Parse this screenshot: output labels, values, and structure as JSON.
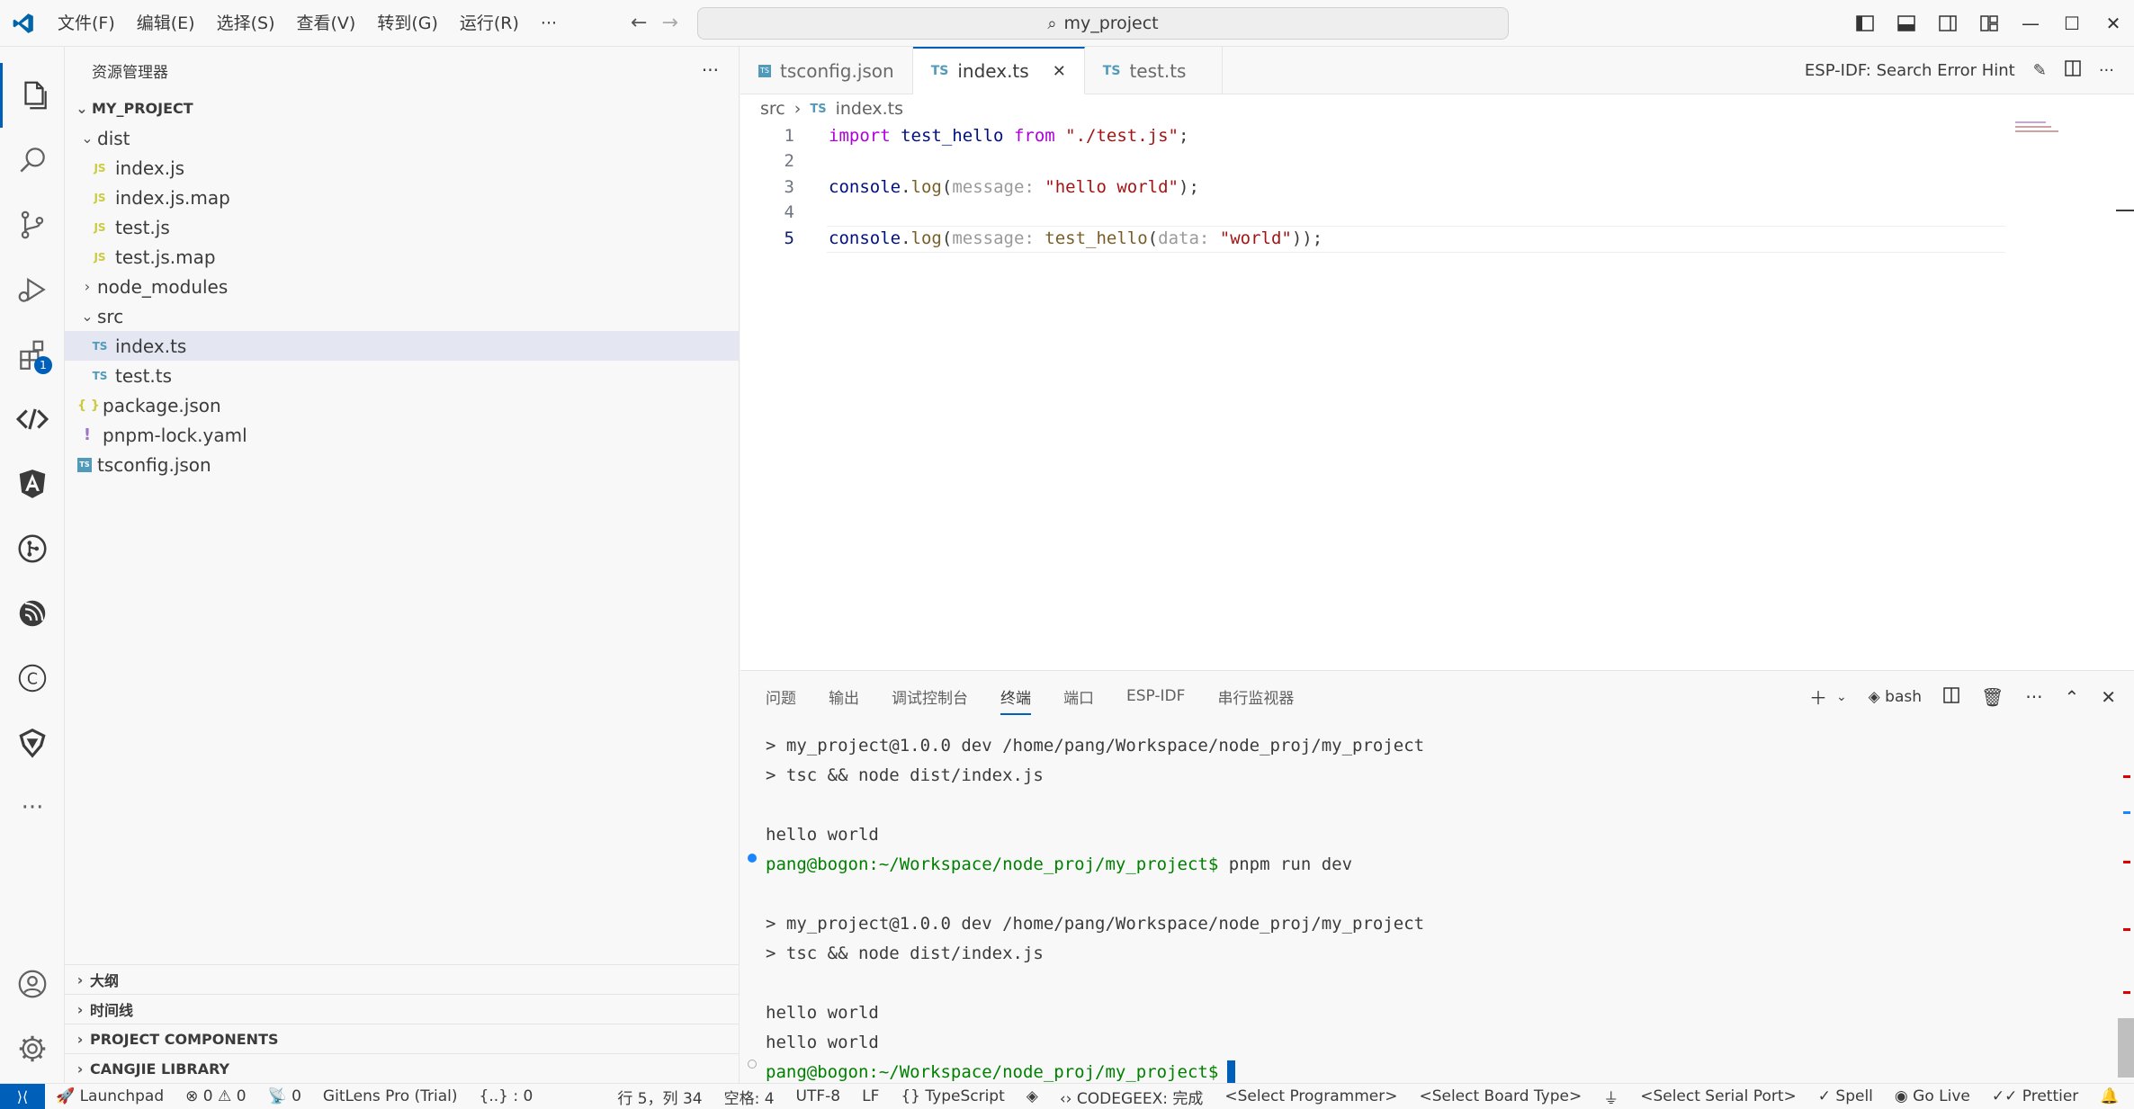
{
  "menu": [
    "文件(F)",
    "编辑(E)",
    "选择(S)",
    "查看(V)",
    "转到(G)",
    "运行(R)",
    "···"
  ],
  "search": {
    "text": "my_project"
  },
  "sidebar": {
    "title": "资源管理器",
    "project": "MY_PROJECT",
    "tree": [
      {
        "label": "dist",
        "type": "folder-open",
        "depth": 1
      },
      {
        "label": "index.js",
        "type": "JS",
        "depth": 2
      },
      {
        "label": "index.js.map",
        "type": "JS",
        "depth": 2
      },
      {
        "label": "test.js",
        "type": "JS",
        "depth": 2
      },
      {
        "label": "test.js.map",
        "type": "JS",
        "depth": 2
      },
      {
        "label": "node_modules",
        "type": "folder-closed",
        "depth": 1
      },
      {
        "label": "src",
        "type": "folder-open",
        "depth": 1
      },
      {
        "label": "index.ts",
        "type": "TS",
        "depth": 2,
        "selected": true
      },
      {
        "label": "test.ts",
        "type": "TS",
        "depth": 2
      },
      {
        "label": "package.json",
        "type": "{}",
        "depth": 1
      },
      {
        "label": "pnpm-lock.yaml",
        "type": "!",
        "depth": 1
      },
      {
        "label": "tsconfig.json",
        "type": "TSC",
        "depth": 1
      }
    ],
    "sections": [
      "大纲",
      "时间线",
      "PROJECT COMPONENTS",
      "CANGJIE LIBRARY"
    ]
  },
  "tabs": [
    {
      "label": "tsconfig.json",
      "active": false
    },
    {
      "label": "index.ts",
      "active": true
    },
    {
      "label": "test.ts",
      "active": false
    }
  ],
  "tab_actions": {
    "hint": "ESP-IDF: Search Error Hint"
  },
  "breadcrumb": [
    "src",
    "index.ts"
  ],
  "code": {
    "line_numbers": [
      "1",
      "2",
      "3",
      "4",
      "5"
    ],
    "l1_import": "import",
    "l1_name": "test_hello",
    "l1_from": "from",
    "l1_path": "\"./test.js\"",
    "l1_end": ";",
    "l3_console": "console",
    "l3_dot": ".",
    "l3_log": "log",
    "l3_open": "(",
    "l3_hint": "message:",
    "l3_str": "\"hello world\"",
    "l3_end": ");",
    "l5_console": "console",
    "l5_dot": ".",
    "l5_log": "log",
    "l5_open": "(",
    "l5_hint": "message:",
    "l5_fn": "test_hello",
    "l5_open2": "(",
    "l5_hint2": "data:",
    "l5_str": "\"world\"",
    "l5_end": "));"
  },
  "panel": {
    "tabs": [
      "问题",
      "输出",
      "调试控制台",
      "终端",
      "端口",
      "ESP-IDF",
      "串行监视器"
    ],
    "active_tab": "终端",
    "shell": "bash",
    "terminal": [
      "> my_project@1.0.0 dev /home/pang/Workspace/node_proj/my_project",
      "> tsc && node dist/index.js",
      "",
      "hello world",
      "",
      "",
      "> my_project@1.0.0 dev /home/pang/Workspace/node_proj/my_project",
      "> tsc && node dist/index.js",
      "",
      "hello world",
      "hello world"
    ],
    "prompt": "pang@bogon:~/Workspace/node_proj/my_project$",
    "command": " pnpm run dev"
  },
  "status": {
    "launchpad": "Launchpad",
    "errors": "0",
    "warnings": "0",
    "ports": "0",
    "gitlens": "GitLens Pro (Trial)",
    "braces": "{..} : 0",
    "position": "行 5，列 34",
    "spaces": "空格: 4",
    "encoding": "UTF-8",
    "eol": "LF",
    "language": "TypeScript",
    "codegeex": "CODEGEEX: 完成",
    "programmer": "<Select Programmer>",
    "board": "<Select Board Type>",
    "serial": "<Select Serial Port>",
    "spell": "Spell",
    "golive": "Go Live",
    "prettier": "Prettier"
  },
  "extensions_badge": "1",
  "colors": {
    "accent": "#005fb8",
    "ts": "#519aba",
    "js": "#cbcb41"
  }
}
